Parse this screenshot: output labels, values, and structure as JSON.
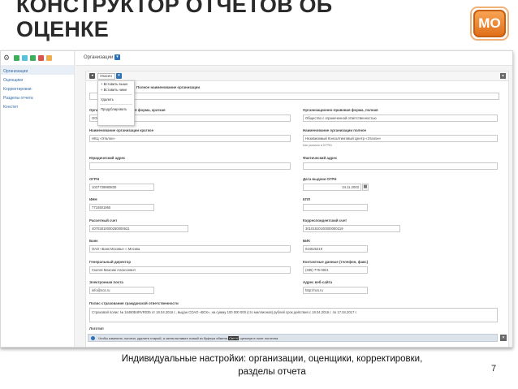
{
  "slide": {
    "title_line1": "КОНСТРУКТОР ОТЧЕТОВ ОБ",
    "title_line2": "ОЦЕНКЕ",
    "logo_text": "МО",
    "caption_line1": "Индивидуальные настройки: организации, оценщики, корректировки,",
    "caption_line2": "разделы отчета",
    "page_number": "7"
  },
  "colors": {
    "accent": "#2f72b8",
    "logo": "#e1701a",
    "toolbar_green": "#3cae5c",
    "toolbar_red": "#d9534f",
    "toolbar_blue": "#5bc0de",
    "toolbar_yellow": "#f0ad4e"
  },
  "toolbar": {
    "gear_icon": "gear-icon"
  },
  "sidebar": {
    "items": [
      "Организации",
      "Оценщики",
      "Корректировки",
      "Разделы отчета",
      "Констит"
    ]
  },
  "header": {
    "breadcrumb": "Организации"
  },
  "form_bar": {
    "select_value": "Упасен"
  },
  "context_menu": {
    "items": [
      "+ Вставить выше",
      "+ Вставить ниже",
      "Удалить",
      "Продублировать"
    ]
  },
  "fields": {
    "full_name_label": "Полное наименование организации",
    "short_legal_form_label": "Организационно-правовая форма, краткая",
    "short_legal_form_value": "ООО",
    "full_legal_form_label": "Организационно-правовая форма, полная",
    "full_legal_form_value": "Общество с ограниченной ответственностью",
    "short_name_label": "Наименование организации краткое",
    "short_name_value": "НКЦ «Эталон»",
    "full_name2_label": "Наименование организации полное",
    "full_name2_value": "Независимый Консалтинговый Центр «Эталон»",
    "full_name2_hint": "Как указано в ЕГРЮ",
    "legal_address_label": "Юридический адрес",
    "actual_address_label": "Фактический адрес",
    "ogrn_label": "ОГРН",
    "ogrn_value": "1037739980830",
    "ogrn_date_label": "Дата выдачи ОГРН",
    "ogrn_date_value": "24.11.2003",
    "inn_label": "ИНН",
    "inn_value": "7715501965",
    "kpp_label": "КПП",
    "account_label": "Расчетный счет",
    "account_value": "40702810000260000631",
    "corr_account_label": "Корреспондентский счет",
    "corr_account_value": "30101810100000000219",
    "bank_label": "Банк",
    "bank_value": "ОАО «Банк Москвы» г. Москва",
    "bik_label": "БИК",
    "bik_value": "044525219",
    "director_label": "Генеральный директор",
    "director_value": "Скатов Максим Алексеевич",
    "contacts_label": "Контактные данные (телефон, факс)",
    "contacts_value": "(495) 775-0821",
    "email_label": "Электронная почта",
    "email_value": "info@ncs.ru",
    "website_label": "Адрес веб-сайта",
    "website_value": "http://ncs.ru",
    "insurance_label": "Полис страхования гражданской ответственности",
    "insurance_value": "Страховой полис № 16480B4RVR035 от 18.04.2016 г., выдан СОАО «ВСК», на сумму 100 000 000 (сто миллионов) рублей срок действия с 18.04.2016 г. по 17.04.2017 г.",
    "logo_label": "Логотип",
    "logo_hint": "Чтобы изменить логотип, удалите старый, а затем вставьте новый из буфера обмена",
    "logo_hint_key": "Ctrl+V",
    "logo_hint_tail": "щелкнув в поле логотипа"
  }
}
